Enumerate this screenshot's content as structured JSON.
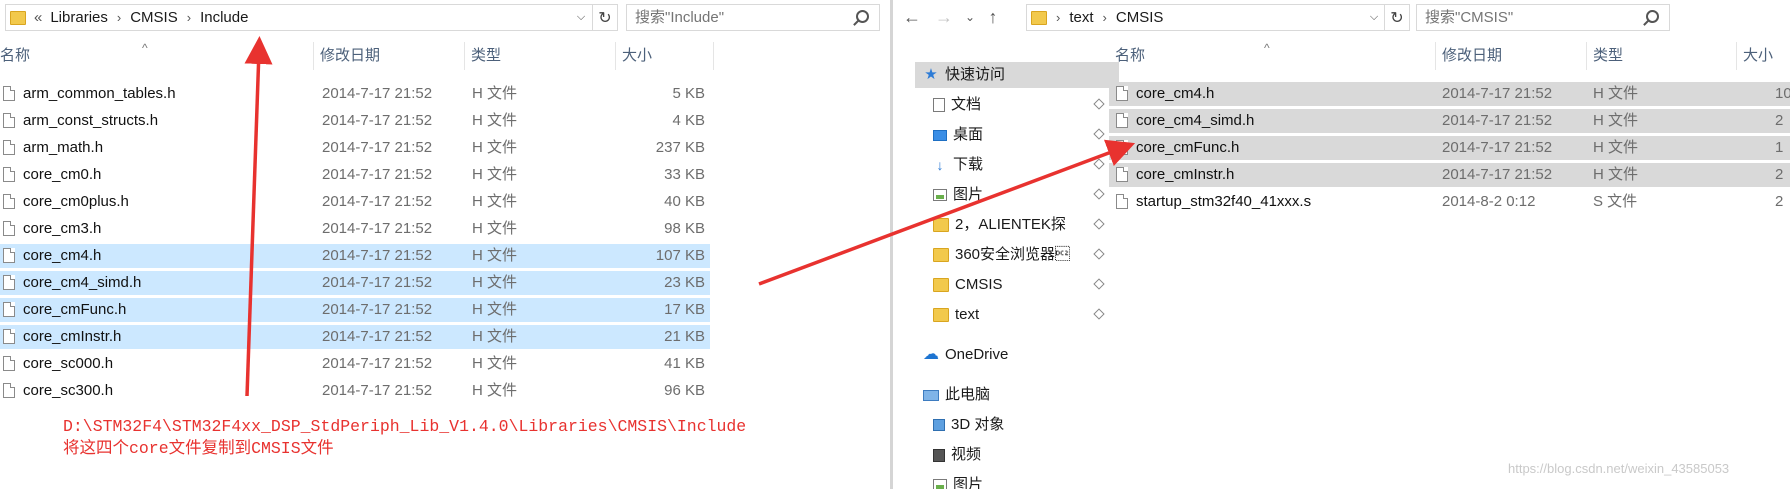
{
  "left_window": {
    "breadcrumb": [
      "«",
      "Libraries",
      "CMSIS",
      "Include"
    ],
    "search_placeholder": "搜索\"Include\"",
    "columns": {
      "name": "名称",
      "date": "修改日期",
      "type": "类型",
      "size": "大小"
    },
    "files": [
      {
        "name": "arm_common_tables.h",
        "date": "2014-7-17 21:52",
        "type": "H 文件",
        "size": "5 KB",
        "selected": false
      },
      {
        "name": "arm_const_structs.h",
        "date": "2014-7-17 21:52",
        "type": "H 文件",
        "size": "4 KB",
        "selected": false
      },
      {
        "name": "arm_math.h",
        "date": "2014-7-17 21:52",
        "type": "H 文件",
        "size": "237 KB",
        "selected": false
      },
      {
        "name": "core_cm0.h",
        "date": "2014-7-17 21:52",
        "type": "H 文件",
        "size": "33 KB",
        "selected": false
      },
      {
        "name": "core_cm0plus.h",
        "date": "2014-7-17 21:52",
        "type": "H 文件",
        "size": "40 KB",
        "selected": false
      },
      {
        "name": "core_cm3.h",
        "date": "2014-7-17 21:52",
        "type": "H 文件",
        "size": "98 KB",
        "selected": false
      },
      {
        "name": "core_cm4.h",
        "date": "2014-7-17 21:52",
        "type": "H 文件",
        "size": "107 KB",
        "selected": true
      },
      {
        "name": "core_cm4_simd.h",
        "date": "2014-7-17 21:52",
        "type": "H 文件",
        "size": "23 KB",
        "selected": true
      },
      {
        "name": "core_cmFunc.h",
        "date": "2014-7-17 21:52",
        "type": "H 文件",
        "size": "17 KB",
        "selected": true
      },
      {
        "name": "core_cmInstr.h",
        "date": "2014-7-17 21:52",
        "type": "H 文件",
        "size": "21 KB",
        "selected": true
      },
      {
        "name": "core_sc000.h",
        "date": "2014-7-17 21:52",
        "type": "H 文件",
        "size": "41 KB",
        "selected": false
      },
      {
        "name": "core_sc300.h",
        "date": "2014-7-17 21:52",
        "type": "H 文件",
        "size": "96 KB",
        "selected": false
      }
    ]
  },
  "right_window": {
    "breadcrumb": [
      "text",
      "CMSIS"
    ],
    "search_placeholder": "搜索\"CMSIS\"",
    "columns": {
      "name": "名称",
      "date": "修改日期",
      "type": "类型",
      "size": "大小"
    },
    "files": [
      {
        "name": "core_cm4.h",
        "date": "2014-7-17 21:52",
        "type": "H 文件",
        "size": "10",
        "selected": true
      },
      {
        "name": "core_cm4_simd.h",
        "date": "2014-7-17 21:52",
        "type": "H 文件",
        "size": "2",
        "selected": true
      },
      {
        "name": "core_cmFunc.h",
        "date": "2014-7-17 21:52",
        "type": "H 文件",
        "size": "1",
        "selected": true
      },
      {
        "name": "core_cmInstr.h",
        "date": "2014-7-17 21:52",
        "type": "H 文件",
        "size": "2",
        "selected": true
      },
      {
        "name": "startup_stm32f40_41xxx.s",
        "date": "2014-8-2 0:12",
        "type": "S 文件",
        "size": "2",
        "selected": false
      }
    ],
    "nav_tree": [
      {
        "label": "快速访问",
        "icon": "star-icon",
        "pinned": false,
        "indent": 0
      },
      {
        "label": "文档",
        "icon": "documents-icon",
        "pinned": true,
        "indent": 1
      },
      {
        "label": "桌面",
        "icon": "desktop-icon",
        "pinned": true,
        "indent": 1
      },
      {
        "label": "下载",
        "icon": "download-icon",
        "pinned": true,
        "indent": 1
      },
      {
        "label": "图片",
        "icon": "pictures-icon",
        "pinned": true,
        "indent": 1
      },
      {
        "label": "2，ALIENTEK探",
        "icon": "folder-icon",
        "pinned": true,
        "indent": 1
      },
      {
        "label": "360安全浏览器\u0012",
        "icon": "folder-icon",
        "pinned": true,
        "indent": 1
      },
      {
        "label": "CMSIS",
        "icon": "folder-icon",
        "pinned": true,
        "indent": 1
      },
      {
        "label": "text",
        "icon": "folder-icon",
        "pinned": true,
        "indent": 1
      },
      {
        "label": "OneDrive",
        "icon": "cloud-icon",
        "pinned": false,
        "indent": 0
      },
      {
        "label": "此电脑",
        "icon": "computer-icon",
        "pinned": false,
        "indent": 0
      },
      {
        "label": "3D 对象",
        "icon": "3d-objects-icon",
        "pinned": false,
        "indent": 1
      },
      {
        "label": "视频",
        "icon": "video-icon",
        "pinned": false,
        "indent": 1
      },
      {
        "label": "图片",
        "icon": "pictures-icon",
        "pinned": false,
        "indent": 1
      }
    ]
  },
  "annotation": {
    "path_line": "D:\\STM32F4\\STM32F4xx_DSP_StdPeriph_Lib_V1.4.0\\Libraries\\CMSIS\\Include",
    "instruction_line": "将这四个core文件复制到CMSIS文件",
    "color": "#e8322f"
  },
  "watermark": "https://blog.csdn.net/weixin_43585053",
  "colors": {
    "left_selection": "#cce8ff",
    "right_selection": "#d9d9d9",
    "arrow": "#e8322f"
  }
}
